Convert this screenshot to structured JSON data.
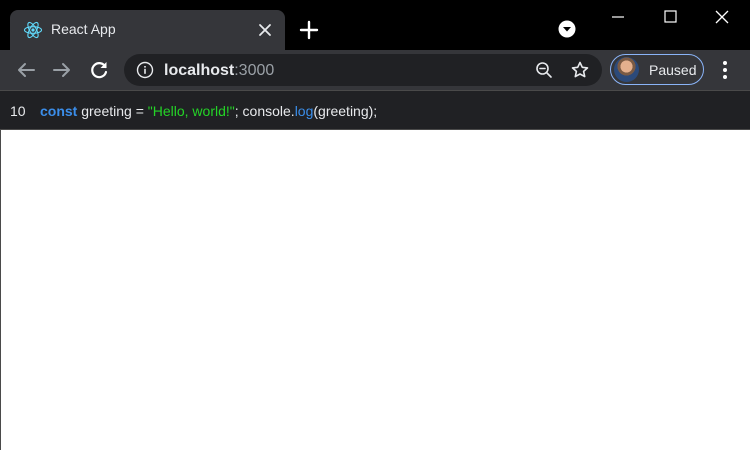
{
  "tab": {
    "title": "React App",
    "favicon_icon": "react-logo-icon",
    "close_icon": "close-icon"
  },
  "tabstrip": {
    "new_tab_icon": "plus-icon",
    "tab_search_icon": "chevron-down-circle-icon"
  },
  "window_controls": {
    "minimize_icon": "minimize-icon",
    "maximize_icon": "maximize-icon",
    "close_icon": "close-icon"
  },
  "toolbar": {
    "back_icon": "arrow-left-icon",
    "forward_icon": "arrow-right-icon",
    "reload_icon": "reload-icon",
    "url_host": "localhost",
    "url_port": ":3000",
    "site_info_icon": "info-icon",
    "zoom_icon": "zoom-out-icon",
    "bookmark_icon": "star-icon",
    "profile_label": "Paused",
    "menu_icon": "more-vertical-icon"
  },
  "code_line": {
    "line_number": "10",
    "tokens": {
      "keyword": "const",
      "plain1": " greeting = ",
      "string": "\"Hello, world!\"",
      "plain2": "; console.",
      "func": "log",
      "plain3": "(greeting);"
    }
  },
  "colors": {
    "tabstrip_bg": "#000000",
    "toolbar_bg": "#35363a",
    "omnibox_bg": "#202124",
    "keyword": "#3b8eea",
    "string": "#24d427",
    "profile_outline": "#8ab4f8"
  }
}
